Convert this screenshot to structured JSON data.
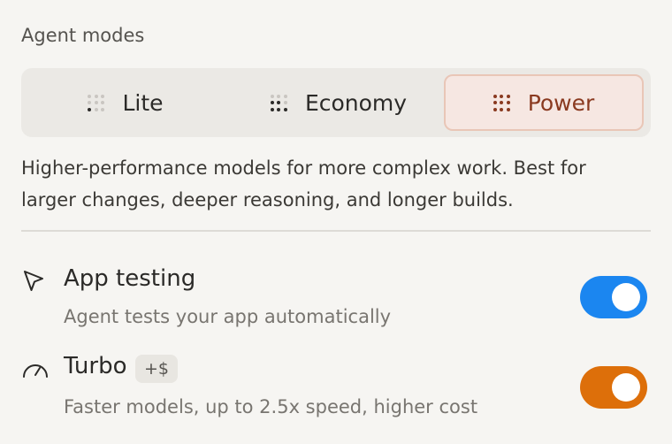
{
  "agent_modes": {
    "title": "Agent modes",
    "options": [
      {
        "label": "Lite",
        "icon": "dots-level-1-icon",
        "selected": false
      },
      {
        "label": "Economy",
        "icon": "dots-level-2-icon",
        "selected": false
      },
      {
        "label": "Power",
        "icon": "dots-level-3-icon",
        "selected": true
      }
    ],
    "description": "Higher-performance models for more complex work. Best for larger changes, deeper reasoning, and longer builds."
  },
  "settings": [
    {
      "title": "App testing",
      "subtitle": "Agent tests your app automatically",
      "icon": "cursor-arrow-icon",
      "enabled": true,
      "toggle_color": "#1b86f0"
    },
    {
      "title": "Turbo",
      "badge": "+$",
      "subtitle": "Faster models, up to 2.5x speed, higher cost",
      "icon": "speedometer-icon",
      "enabled": true,
      "toggle_color": "#dd6f0a"
    }
  ],
  "colors": {
    "background": "#f6f5f2",
    "selected_mode_bg": "#f6e7e2",
    "selected_mode_text": "#8a3a20"
  }
}
